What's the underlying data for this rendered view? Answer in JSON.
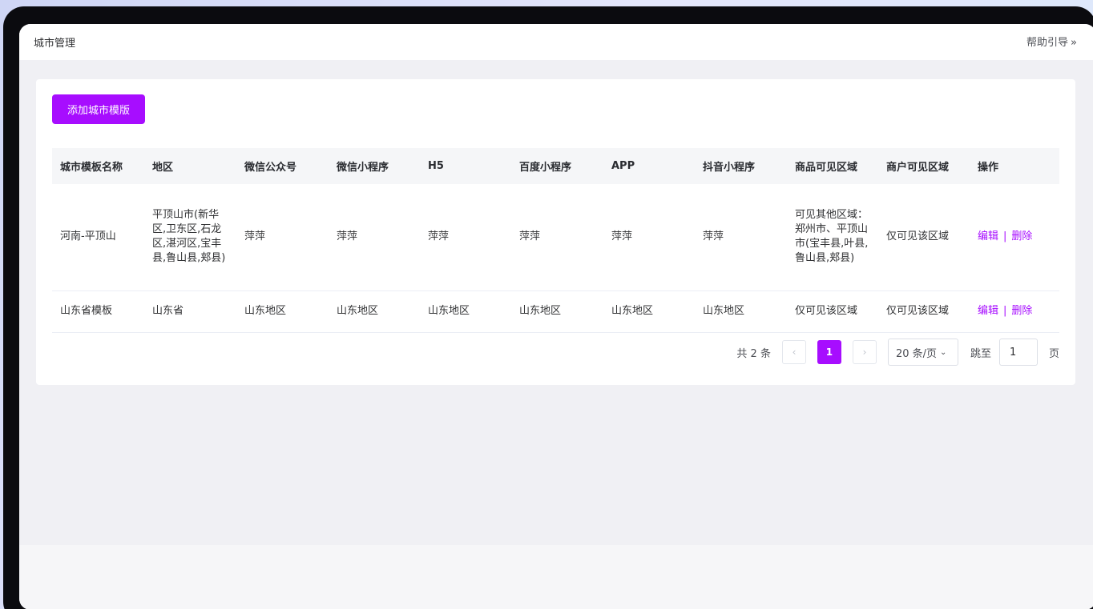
{
  "header": {
    "title": "城市管理",
    "help_label": "帮助引导",
    "help_chevron": "»"
  },
  "toolbar": {
    "add_label": "添加城市模版"
  },
  "table": {
    "columns": [
      "城市模板名称",
      "地区",
      "微信公众号",
      "微信小程序",
      "H5",
      "百度小程序",
      "APP",
      "抖音小程序",
      "商品可见区域",
      "商户可见区域",
      "操作"
    ],
    "rows": [
      {
        "name": "河南-平顶山",
        "region": "平顶山市(新华区,卫东区,石龙区,湛河区,宝丰县,鲁山县,郏县)",
        "wechat_mp": "萍萍",
        "wechat_mini": "萍萍",
        "h5": "萍萍",
        "baidu_mini": "萍萍",
        "app": "萍萍",
        "douyin_mini": "萍萍",
        "goods_visible": "可见其他区域：郑州市、平顶山市(宝丰县,叶县,鲁山县,郏县)",
        "merchant_visible": "仅可见该区域",
        "edit_label": "编辑",
        "delete_label": "删除"
      },
      {
        "name": "山东省模板",
        "region": "山东省",
        "wechat_mp": "山东地区",
        "wechat_mini": "山东地区",
        "h5": "山东地区",
        "baidu_mini": "山东地区",
        "app": "山东地区",
        "douyin_mini": "山东地区",
        "goods_visible": "仅可见该区域",
        "merchant_visible": "仅可见该区域",
        "edit_label": "编辑",
        "delete_label": "删除"
      }
    ],
    "action_separator": "|"
  },
  "pagination": {
    "total_text": "共 2 条",
    "prev_icon": "‹",
    "current_page": "1",
    "next_icon": "›",
    "page_size_label": "20 条/页",
    "jump_label": "跳至",
    "jump_value": "1",
    "page_suffix": "页"
  },
  "colors": {
    "accent": "#a70dff",
    "background": "#f0f0f4",
    "card": "#ffffff",
    "header_row": "#f5f6f8"
  }
}
